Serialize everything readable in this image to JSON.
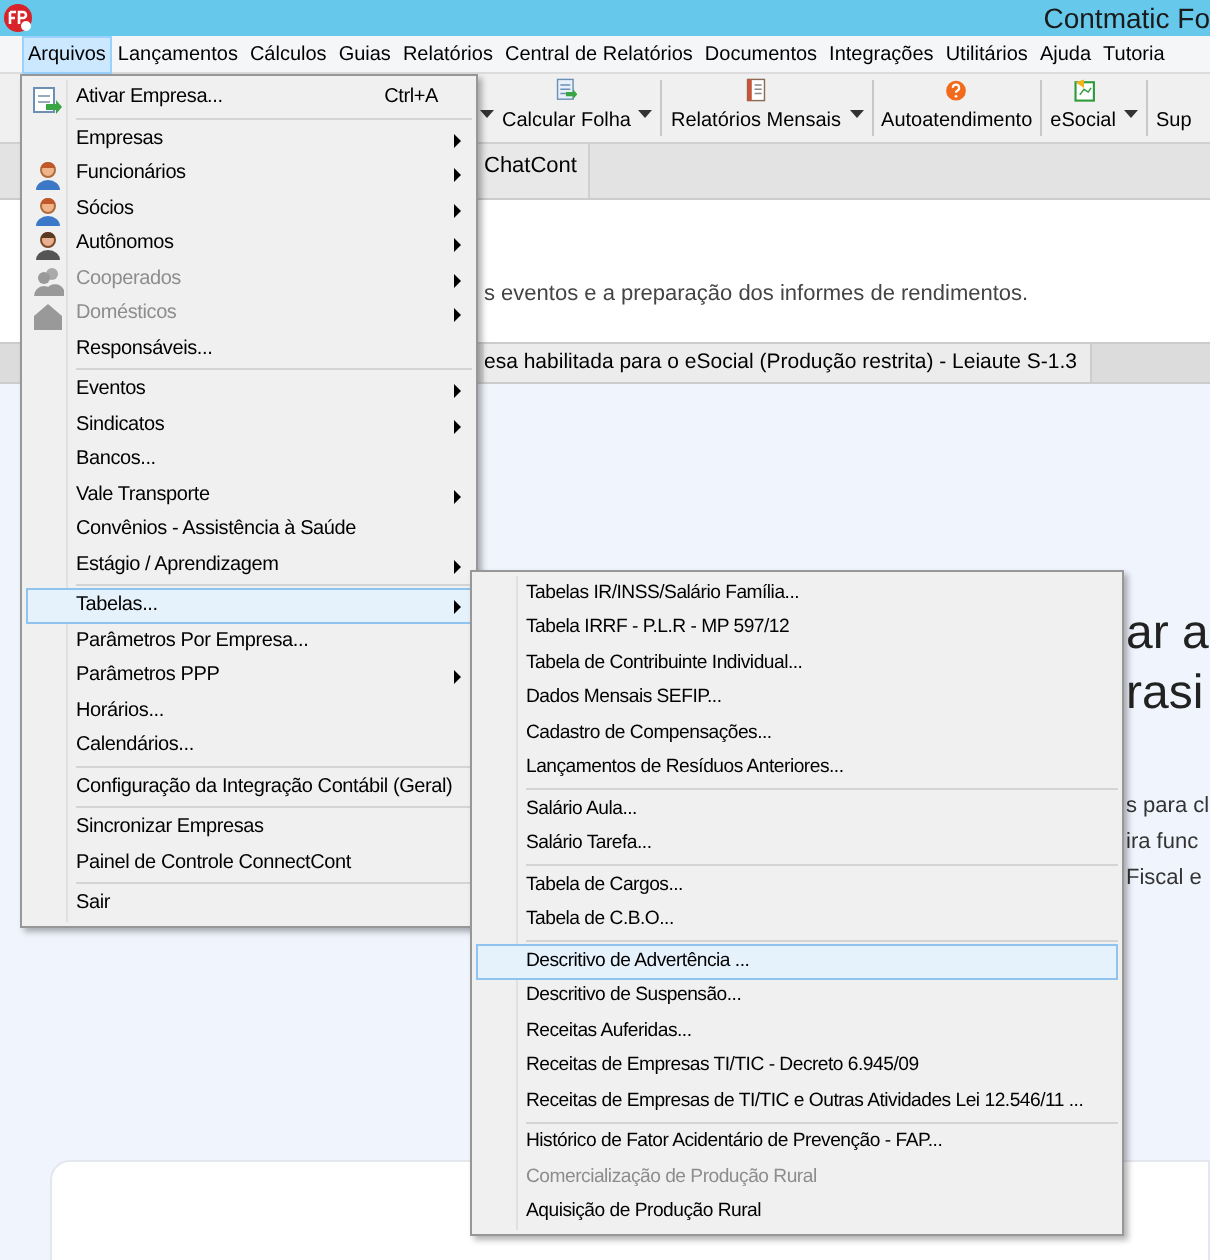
{
  "window": {
    "title": "Contmatic Fo"
  },
  "menubar": [
    {
      "label": "Arquivos",
      "selected": true
    },
    {
      "label": "Lançamentos",
      "selected": false
    },
    {
      "label": "Cálculos",
      "selected": false
    },
    {
      "label": "Guias",
      "selected": false
    },
    {
      "label": "Relatórios",
      "selected": false
    },
    {
      "label": "Central de Relatórios",
      "selected": false
    },
    {
      "label": "Documentos",
      "selected": false
    },
    {
      "label": "Integrações",
      "selected": false
    },
    {
      "label": "Utilitários",
      "selected": false
    },
    {
      "label": "Ajuda",
      "selected": false
    },
    {
      "label": "Tutoria",
      "selected": false
    }
  ],
  "toolbar": [
    {
      "kind": "caret"
    },
    {
      "kind": "button",
      "label": "Calcular Folha",
      "dropdown": true
    },
    {
      "kind": "button",
      "label": "Relatórios Mensais",
      "dropdown": true
    },
    {
      "kind": "button",
      "label": "Autoatendimento",
      "dropdown": false
    },
    {
      "kind": "separator"
    },
    {
      "kind": "button",
      "label": "eSocial",
      "dropdown": true
    },
    {
      "kind": "button",
      "label": "Sup",
      "dropdown": false
    }
  ],
  "tabs": [
    {
      "label": "ChatCont",
      "selected": true
    }
  ],
  "notice": {
    "text": "s eventos e a preparação dos informes de rendimentos."
  },
  "status": {
    "text": "esa habilitada para o eSocial (Produção restrita) - Leiaute S-1.3"
  },
  "welcome": {
    "heading": [
      "ar a",
      "rasi"
    ],
    "lines": [
      "s para cl",
      "ira func",
      "Fiscal e"
    ]
  },
  "file_menu": [
    {
      "kind": "item",
      "label": "Ativar Empresa...",
      "shortcut": "Ctrl+A",
      "submenu": false,
      "disabled": false,
      "selected": false
    },
    {
      "kind": "separator"
    },
    {
      "kind": "item",
      "label": "Empresas",
      "submenu": true,
      "disabled": false,
      "selected": false
    },
    {
      "kind": "item",
      "label": "Funcionários",
      "submenu": true,
      "disabled": false,
      "selected": false
    },
    {
      "kind": "item",
      "label": "Sócios",
      "submenu": true,
      "disabled": false,
      "selected": false
    },
    {
      "kind": "item",
      "label": "Autônomos",
      "submenu": true,
      "disabled": false,
      "selected": false
    },
    {
      "kind": "item",
      "label": "Cooperados",
      "submenu": true,
      "disabled": true,
      "selected": false
    },
    {
      "kind": "item",
      "label": "Domésticos",
      "submenu": true,
      "disabled": true,
      "selected": false
    },
    {
      "kind": "item",
      "label": "Responsáveis...",
      "submenu": false,
      "disabled": false,
      "selected": false
    },
    {
      "kind": "separator"
    },
    {
      "kind": "item",
      "label": "Eventos",
      "submenu": true,
      "disabled": false,
      "selected": false
    },
    {
      "kind": "item",
      "label": "Sindicatos",
      "submenu": true,
      "disabled": false,
      "selected": false
    },
    {
      "kind": "item",
      "label": "Bancos...",
      "submenu": false,
      "disabled": false,
      "selected": false
    },
    {
      "kind": "item",
      "label": "Vale Transporte",
      "submenu": true,
      "disabled": false,
      "selected": false
    },
    {
      "kind": "item",
      "label": "Convênios - Assistência à Saúde",
      "submenu": false,
      "disabled": false,
      "selected": false
    },
    {
      "kind": "item",
      "label": "Estágio / Aprendizagem",
      "submenu": true,
      "disabled": false,
      "selected": false
    },
    {
      "kind": "separator"
    },
    {
      "kind": "item",
      "label": "Tabelas...",
      "submenu": true,
      "disabled": false,
      "selected": true
    },
    {
      "kind": "item",
      "label": "Parâmetros Por Empresa...",
      "submenu": false,
      "disabled": false,
      "selected": false
    },
    {
      "kind": "item",
      "label": "Parâmetros PPP",
      "submenu": true,
      "disabled": false,
      "selected": false
    },
    {
      "kind": "item",
      "label": "Horários...",
      "submenu": false,
      "disabled": false,
      "selected": false
    },
    {
      "kind": "item",
      "label": "Calendários...",
      "submenu": false,
      "disabled": false,
      "selected": false
    },
    {
      "kind": "separator"
    },
    {
      "kind": "item",
      "label": "Configuração da Integração Contábil (Geral)",
      "submenu": false,
      "disabled": false,
      "selected": false
    },
    {
      "kind": "separator"
    },
    {
      "kind": "item",
      "label": "Sincronizar Empresas",
      "submenu": false,
      "disabled": false,
      "selected": false
    },
    {
      "kind": "item",
      "label": "Painel de Controle ConnectCont",
      "submenu": false,
      "disabled": false,
      "selected": false
    },
    {
      "kind": "separator"
    },
    {
      "kind": "item",
      "label": "Sair",
      "submenu": false,
      "disabled": false,
      "selected": false
    }
  ],
  "tables_menu": [
    {
      "kind": "item",
      "label": "Tabelas IR/INSS/Salário Família...",
      "disabled": false,
      "selected": false
    },
    {
      "kind": "item",
      "label": "Tabela IRRF - P.L.R - MP 597/12",
      "disabled": false,
      "selected": false
    },
    {
      "kind": "item",
      "label": "Tabela de Contribuinte Individual...",
      "disabled": false,
      "selected": false
    },
    {
      "kind": "item",
      "label": "Dados Mensais SEFIP...",
      "disabled": false,
      "selected": false
    },
    {
      "kind": "item",
      "label": "Cadastro de Compensações...",
      "disabled": false,
      "selected": false
    },
    {
      "kind": "item",
      "label": "Lançamentos de Resíduos Anteriores...",
      "disabled": false,
      "selected": false
    },
    {
      "kind": "separator"
    },
    {
      "kind": "item",
      "label": "Salário Aula...",
      "disabled": false,
      "selected": false
    },
    {
      "kind": "item",
      "label": "Salário Tarefa...",
      "disabled": false,
      "selected": false
    },
    {
      "kind": "separator"
    },
    {
      "kind": "item",
      "label": "Tabela de Cargos...",
      "disabled": false,
      "selected": false
    },
    {
      "kind": "item",
      "label": "Tabela de C.B.O...",
      "disabled": false,
      "selected": false
    },
    {
      "kind": "separator"
    },
    {
      "kind": "item",
      "label": "Descritivo de Advertência ...",
      "disabled": false,
      "selected": true
    },
    {
      "kind": "item",
      "label": "Descritivo de Suspensão...",
      "disabled": false,
      "selected": false
    },
    {
      "kind": "item",
      "label": "Receitas Auferidas...",
      "disabled": false,
      "selected": false
    },
    {
      "kind": "item",
      "label": "Receitas de Empresas TI/TIC - Decreto 6.945/09",
      "disabled": false,
      "selected": false
    },
    {
      "kind": "item",
      "label": "Receitas de Empresas de TI/TIC e Outras Atividades Lei 12.546/11 ...",
      "disabled": false,
      "selected": false
    },
    {
      "kind": "separator"
    },
    {
      "kind": "item",
      "label": "Histórico de Fator Acidentário de Prevenção - FAP...",
      "disabled": false,
      "selected": false
    },
    {
      "kind": "item",
      "label": "Comercialização de Produção Rural",
      "disabled": true,
      "selected": false
    },
    {
      "kind": "item",
      "label": "Aquisição de Produção Rural",
      "disabled": false,
      "selected": false
    }
  ]
}
